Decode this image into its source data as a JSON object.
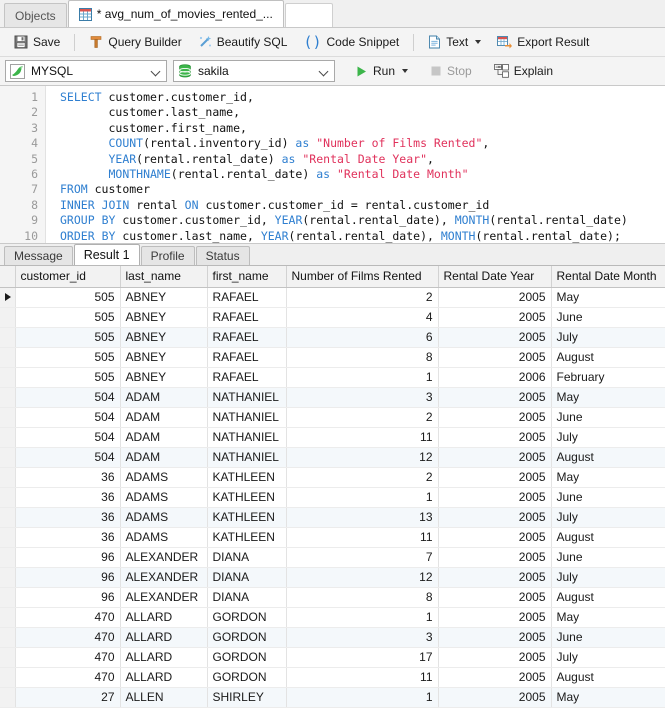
{
  "tabs": [
    {
      "label": "Objects",
      "icon": "",
      "active": false,
      "modified": false
    },
    {
      "label": "* avg_num_of_movies_rented_...",
      "icon": "table-grid-icon",
      "active": true,
      "modified": true
    }
  ],
  "toolbar": {
    "save_label": "Save",
    "query_builder_label": "Query Builder",
    "beautify_label": "Beautify SQL",
    "code_snippet_label": "Code Snippet",
    "text_label": "Text",
    "export_result_label": "Export Result",
    "icons": {
      "save": "floppy-disk-icon",
      "query_builder": "builder-t-icon",
      "beautify": "magic-wand-icon",
      "code_snippet": "parentheses-icon",
      "text": "document-icon",
      "export_result": "export-table-icon"
    }
  },
  "connection_bar": {
    "connection": {
      "value": "MYSQL",
      "icon": "mysql-dolphin-icon"
    },
    "database": {
      "value": "sakila",
      "icon": "database-cylinder-icon"
    },
    "run_label": "Run",
    "stop_label": "Stop",
    "explain_label": "Explain",
    "stop_enabled": false,
    "icons": {
      "run": "play-triangle-icon",
      "stop": "stop-square-icon",
      "explain": "explain-plan-icon"
    }
  },
  "editor": {
    "line_numbers": [
      1,
      2,
      3,
      4,
      5,
      6,
      7,
      8,
      9,
      10
    ],
    "lines": [
      "SELECT customer.customer_id,",
      "       customer.last_name,",
      "       customer.first_name,",
      "       COUNT(rental.inventory_id) as \"Number of Films Rented\",",
      "       YEAR(rental.rental_date) as \"Rental Date Year\",",
      "       MONTHNAME(rental.rental_date) as \"Rental Date Month\"",
      "FROM customer",
      "INNER JOIN rental ON customer.customer_id = rental.customer_id",
      "GROUP BY customer.customer_id, YEAR(rental.rental_date), MONTH(rental.rental_date)",
      "ORDER BY customer.last_name, YEAR(rental.rental_date), MONTH(rental.rental_date);"
    ]
  },
  "result_tabs": [
    {
      "label": "Message",
      "active": false
    },
    {
      "label": "Result 1",
      "active": true
    },
    {
      "label": "Profile",
      "active": false
    },
    {
      "label": "Status",
      "active": false
    }
  ],
  "grid": {
    "columns": [
      {
        "name": "customer_id",
        "align": "right",
        "selected": true
      },
      {
        "name": "last_name",
        "align": "left",
        "selected": false
      },
      {
        "name": "first_name",
        "align": "left",
        "selected": false
      },
      {
        "name": "Number of Films Rented",
        "align": "right",
        "selected": false
      },
      {
        "name": "Rental Date Year",
        "align": "right",
        "selected": false
      },
      {
        "name": "Rental Date Month",
        "align": "left",
        "selected": false
      }
    ],
    "current_row_index": 0,
    "rows": [
      [
        "505",
        "ABNEY",
        "RAFAEL",
        "2",
        "2005",
        "May"
      ],
      [
        "505",
        "ABNEY",
        "RAFAEL",
        "4",
        "2005",
        "June"
      ],
      [
        "505",
        "ABNEY",
        "RAFAEL",
        "6",
        "2005",
        "July"
      ],
      [
        "505",
        "ABNEY",
        "RAFAEL",
        "8",
        "2005",
        "August"
      ],
      [
        "505",
        "ABNEY",
        "RAFAEL",
        "1",
        "2006",
        "February"
      ],
      [
        "504",
        "ADAM",
        "NATHANIEL",
        "3",
        "2005",
        "May"
      ],
      [
        "504",
        "ADAM",
        "NATHANIEL",
        "2",
        "2005",
        "June"
      ],
      [
        "504",
        "ADAM",
        "NATHANIEL",
        "11",
        "2005",
        "July"
      ],
      [
        "504",
        "ADAM",
        "NATHANIEL",
        "12",
        "2005",
        "August"
      ],
      [
        "36",
        "ADAMS",
        "KATHLEEN",
        "2",
        "2005",
        "May"
      ],
      [
        "36",
        "ADAMS",
        "KATHLEEN",
        "1",
        "2005",
        "June"
      ],
      [
        "36",
        "ADAMS",
        "KATHLEEN",
        "13",
        "2005",
        "July"
      ],
      [
        "36",
        "ADAMS",
        "KATHLEEN",
        "11",
        "2005",
        "August"
      ],
      [
        "96",
        "ALEXANDER",
        "DIANA",
        "7",
        "2005",
        "June"
      ],
      [
        "96",
        "ALEXANDER",
        "DIANA",
        "12",
        "2005",
        "July"
      ],
      [
        "96",
        "ALEXANDER",
        "DIANA",
        "8",
        "2005",
        "August"
      ],
      [
        "470",
        "ALLARD",
        "GORDON",
        "1",
        "2005",
        "May"
      ],
      [
        "470",
        "ALLARD",
        "GORDON",
        "3",
        "2005",
        "June"
      ],
      [
        "470",
        "ALLARD",
        "GORDON",
        "17",
        "2005",
        "July"
      ],
      [
        "470",
        "ALLARD",
        "GORDON",
        "11",
        "2005",
        "August"
      ],
      [
        "27",
        "ALLEN",
        "SHIRLEY",
        "1",
        "2005",
        "May"
      ]
    ]
  },
  "colors": {
    "keyword": "#2f7fd0",
    "string": "#e0315b",
    "accent_green": "#36a536",
    "selected_header": "#cfe4f5",
    "alt_row": "#f4f8fb"
  }
}
